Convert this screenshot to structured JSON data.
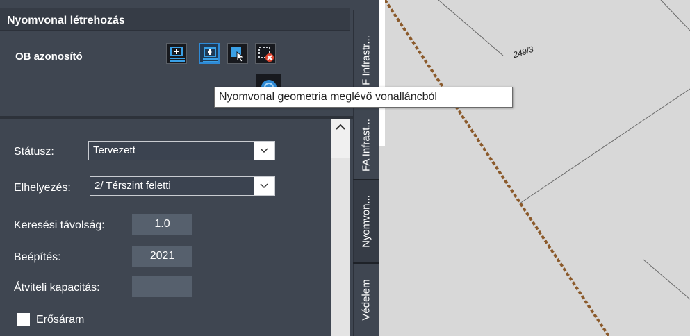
{
  "panel": {
    "title": "Nyomvonal létrehozás",
    "ob_label": "OB azonosító"
  },
  "toolbar": {
    "buttons": [
      {
        "icon": "add-line-icon",
        "active": false
      },
      {
        "icon": "line-from-polyline-icon",
        "active": true
      },
      {
        "icon": "select-arrow-icon",
        "active": false
      },
      {
        "icon": "delete-selection-icon",
        "active": false
      }
    ],
    "secondary_icon": "circle-action-icon"
  },
  "tooltip": {
    "text": "Nyomvonal geometria meglévő vonalláncból"
  },
  "form": {
    "status_label": "Státusz:",
    "status_value": "Tervezett",
    "placement_label": "Elhelyezés:",
    "placement_value": "2/ Térszint feletti",
    "search_distance_label": "Keresési távolság:",
    "search_distance_value": "1.0",
    "build_year_label": "Beépítés:",
    "build_year_value": "2021",
    "capacity_label": "Átviteli kapacitás:",
    "capacity_value": "",
    "heavy_current_label": "Erősáram",
    "heavy_current_checked": false
  },
  "tabs": [
    {
      "label": "F Infrastr...",
      "active": false
    },
    {
      "label": "FA Infrast...",
      "active": false
    },
    {
      "label": "Nyomvon...",
      "active": true
    },
    {
      "label": "Védelem",
      "active": false
    }
  ],
  "map": {
    "parcel_label": "249/3",
    "line_color": "#8b5a2b",
    "background": "#d8d8d8"
  }
}
